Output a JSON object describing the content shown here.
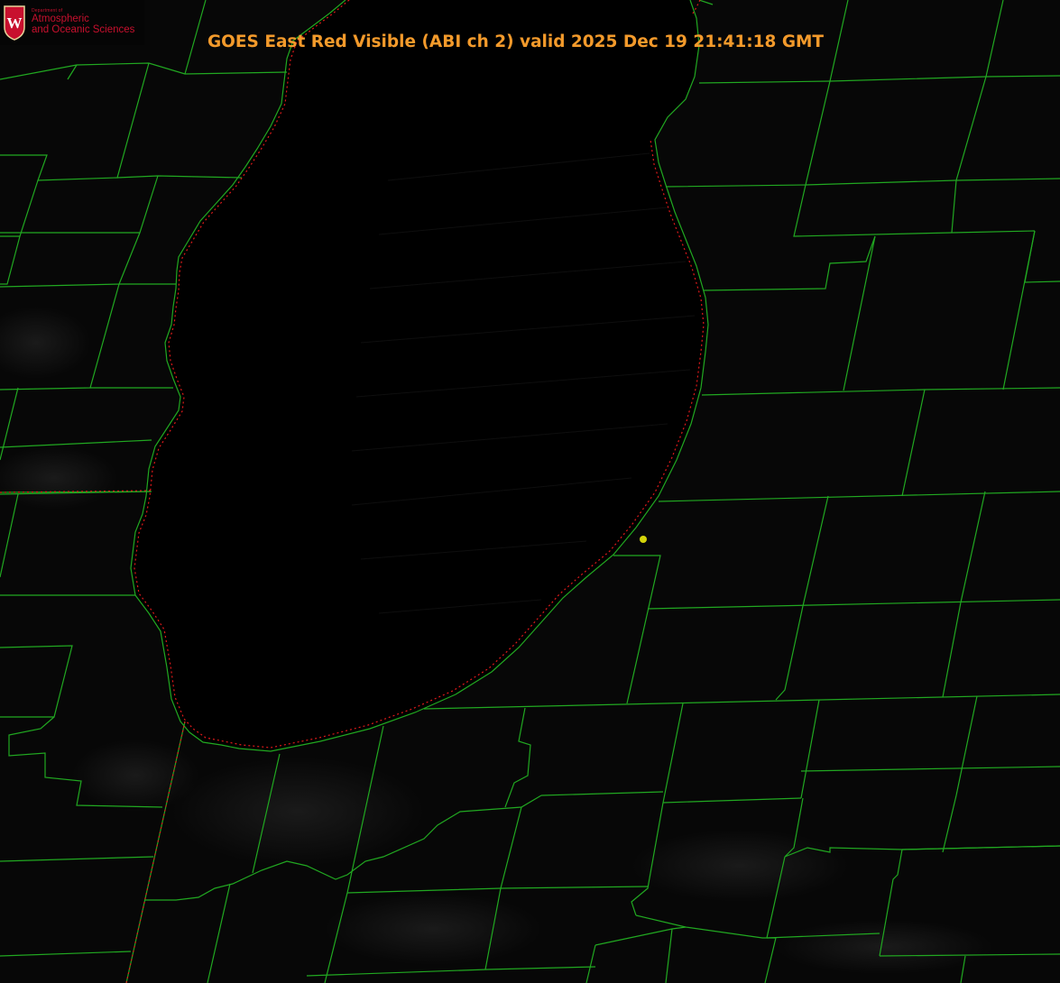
{
  "title": "GOES East Red Visible (ABI ch 2) valid 2025 Dec 19 21:41:18 GMT",
  "logo": {
    "small": "Department of",
    "line1": "Atmospheric",
    "line2": "and Oceanic Sciences",
    "seal_letter": "W"
  },
  "colors": {
    "county_lines": "#21a821",
    "state_border": "#e0191a",
    "title": "#f39a2b",
    "logo_text": "#c8102e",
    "marker": "#d4d40a",
    "lake": "#000000",
    "land": "#060606"
  },
  "icons": {
    "marker": "location-dot-icon",
    "seal": "university-seal-icon"
  }
}
